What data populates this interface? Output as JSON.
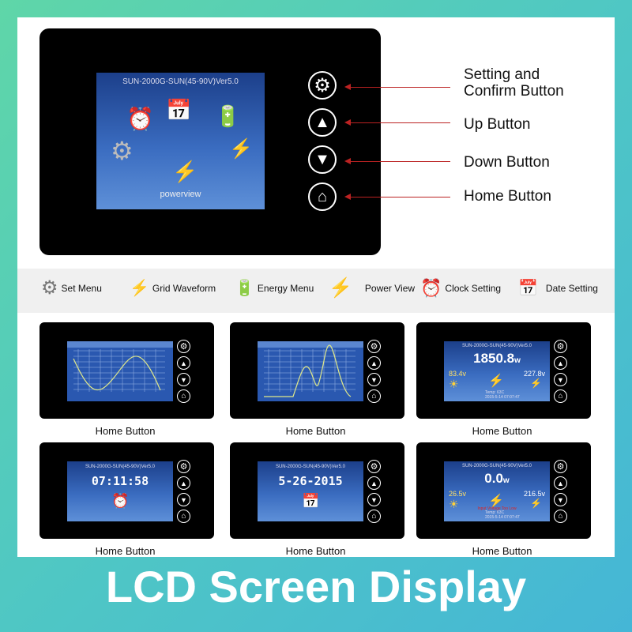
{
  "main_device": {
    "version": "SUN-2000G-SUN(45-90V)Ver5.0",
    "screen_label": "powerview"
  },
  "callouts": [
    {
      "label": "Setting and\nConfirm Button",
      "icon": "gear-icon"
    },
    {
      "label": "Up Button",
      "icon": "up-arrow-icon"
    },
    {
      "label": "Down Button",
      "icon": "down-arrow-icon"
    },
    {
      "label": "Home Button",
      "icon": "home-icon"
    }
  ],
  "legend": [
    {
      "label": "Set Menu",
      "icon": "gear-icon"
    },
    {
      "label": "Grid Waveform",
      "icon": "grid-waveform-icon"
    },
    {
      "label": "Energy Menu",
      "icon": "battery-icon"
    },
    {
      "label": "Power View",
      "icon": "lightning-icon"
    },
    {
      "label": "Clock Setting",
      "icon": "clock-icon"
    },
    {
      "label": "Date Setting",
      "icon": "calendar-icon"
    }
  ],
  "thumbs": [
    {
      "caption": "Home Button",
      "type": "waveform"
    },
    {
      "caption": "Home Button",
      "type": "waveform2"
    },
    {
      "caption": "Home Button",
      "type": "power",
      "version": "SUN-2000G-SUN(45-90V)Ver5.0",
      "power": "1850.8",
      "power_unit": "w",
      "pv": "83.4v",
      "grid": "227.8v",
      "footer": "Temp: 63C\n2015-5-14 07:07:47"
    },
    {
      "caption": "Home Button",
      "type": "clock",
      "version": "SUN-2000G-SUN(45-90V)Ver5.0",
      "value": "07:11:58"
    },
    {
      "caption": "Home Button",
      "type": "date",
      "version": "SUN-2000G-SUN(45-90V)Ver5.0",
      "value": "5-26-2015"
    },
    {
      "caption": "Home Button",
      "type": "power",
      "version": "SUN-2000G-SUN(45-90V)Ver5.0",
      "power": "0.0",
      "power_unit": "w",
      "pv": "26.5v",
      "grid": "216.5v",
      "warning": "Input Voltage Too Low",
      "footer": "Temp: 63C\n2015-5-14 07:07:47"
    }
  ],
  "banner": "LCD Screen Display"
}
